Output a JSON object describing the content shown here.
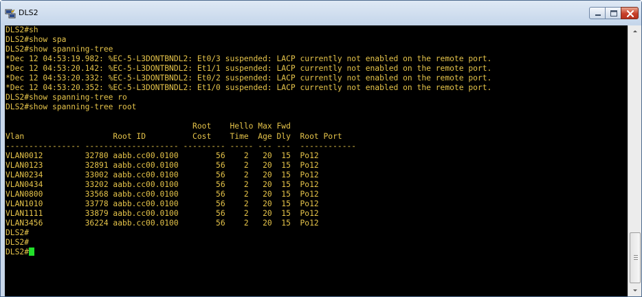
{
  "window": {
    "title": "DLS2",
    "icon": "putty-icon",
    "controls": [
      "minimize-icon",
      "maximize-icon",
      "close-icon"
    ]
  },
  "colors": {
    "terminal_bg": "#000000",
    "terminal_fg": "#e6c44a",
    "cursor": "#22e02a"
  },
  "terminal": {
    "lines": [
      "DLS2#sh",
      "DLS2#show spa",
      "DLS2#show spanning-tree",
      "*Dec 12 04:53:19.982: %EC-5-L3DONTBNDL2: Et0/3 suspended: LACP currently not enabled on the remote port.",
      "*Dec 12 04:53:20.142: %EC-5-L3DONTBNDL2: Et1/1 suspended: LACP currently not enabled on the remote port.",
      "*Dec 12 04:53:20.332: %EC-5-L3DONTBNDL2: Et0/2 suspended: LACP currently not enabled on the remote port.",
      "*Dec 12 04:53:20.352: %EC-5-L3DONTBNDL2: Et1/0 suspended: LACP currently not enabled on the remote port.",
      "DLS2#show spanning-tree ro",
      "DLS2#show spanning-tree root",
      "",
      "                                        Root    Hello Max Fwd",
      "Vlan                   Root ID          Cost    Time  Age Dly  Root Port",
      "---------------- -------------------- --------- ----- --- ---  ------------",
      "VLAN0012         32780 aabb.cc00.0100        56    2   20  15  Po12",
      "VLAN0123         32891 aabb.cc00.0100        56    2   20  15  Po12",
      "VLAN0234         33002 aabb.cc00.0100        56    2   20  15  Po12",
      "VLAN0434         33202 aabb.cc00.0100        56    2   20  15  Po12",
      "VLAN0800         33568 aabb.cc00.0100        56    2   20  15  Po12",
      "VLAN1010         33778 aabb.cc00.0100        56    2   20  15  Po12",
      "VLAN1111         33879 aabb.cc00.0100        56    2   20  15  Po12",
      "VLAN3456         36224 aabb.cc00.0100        56    2   20  15  Po12",
      "DLS2#",
      "DLS2#",
      "DLS2#"
    ]
  }
}
